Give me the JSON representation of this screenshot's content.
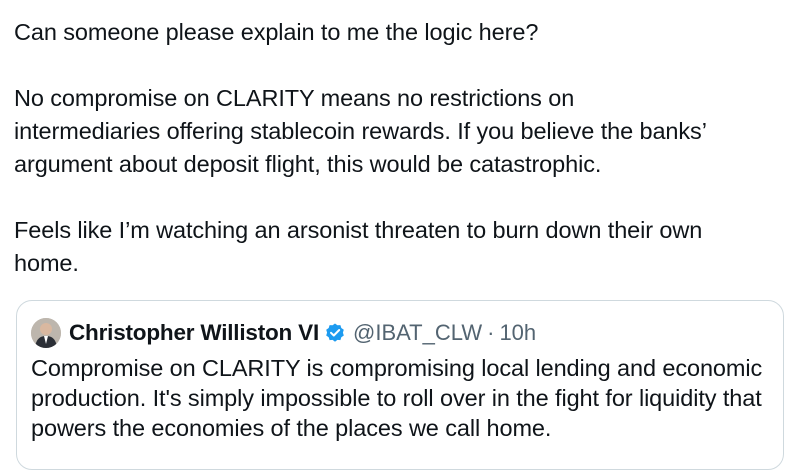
{
  "tweet": {
    "paragraphs": [
      "Can someone please explain to me the logic here?",
      "No compromise on CLARITY means no restrictions on\nintermediaries offering stablecoin rewards. If you believe the banks’\nargument about deposit flight, this would be catastrophic.",
      "Feels like I’m watching an arsonist threaten to burn down their own\nhome."
    ]
  },
  "quote": {
    "author_name": "Christopher Williston VI",
    "verified": true,
    "handle": "@IBAT_CLW",
    "separator": "·",
    "time": "10h",
    "text": "Compromise on CLARITY is compromising local lending and economic production.  It's simply impossible to roll over in the fight for liquidity that powers the economies of the places we call home.",
    "verified_color": "#1d9bf0",
    "icons": {
      "avatar": "avatar-photo",
      "verified": "verified-badge-icon"
    }
  }
}
